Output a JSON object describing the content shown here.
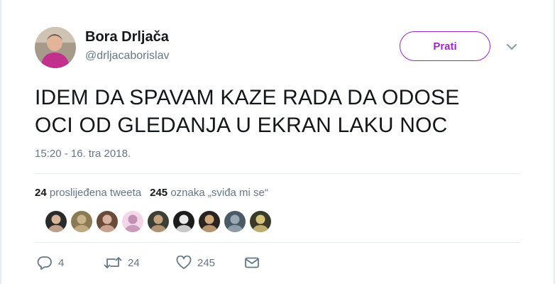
{
  "author": {
    "name": "Bora Drljača",
    "handle": "@drljacaborislav"
  },
  "follow_button": {
    "label": "Prati",
    "color": "#9b27c9"
  },
  "tweet": {
    "line1": "IDEM DA SPAVAM KAZE RADA DA ODOSE",
    "line2": "OCI OD GLEDANJA U EKRAN LAKU NOC",
    "timestamp": "15:20 - 16. tra 2018."
  },
  "stats": {
    "retweets_count": "24",
    "retweets_label": "proslijeđena tweeta",
    "likes_count": "245",
    "likes_label": "oznaka „sviđa mi se“"
  },
  "likers": [
    {
      "colors": [
        "#2b2b2b",
        "#d8b49a"
      ]
    },
    {
      "colors": [
        "#8a7b55",
        "#c9b38a"
      ]
    },
    {
      "colors": [
        "#6b4b3a",
        "#d9b3a0"
      ]
    },
    {
      "colors": [
        "#f2d7e8",
        "#c48fb3"
      ]
    },
    {
      "colors": [
        "#3b3f35",
        "#c7a17d"
      ]
    },
    {
      "colors": [
        "#1c1c1c",
        "#e8e8e8"
      ]
    },
    {
      "colors": [
        "#2a2320",
        "#d1a77e"
      ]
    },
    {
      "colors": [
        "#4a5a66",
        "#9aa9b3"
      ]
    },
    {
      "colors": [
        "#3a3a2a",
        "#d6c27a"
      ]
    }
  ],
  "actions": {
    "reply_count": "4",
    "retweet_count": "24",
    "like_count": "245"
  },
  "icons": [
    "reply-icon",
    "retweet-icon",
    "heart-icon",
    "envelope-icon",
    "chevron-down-icon"
  ]
}
